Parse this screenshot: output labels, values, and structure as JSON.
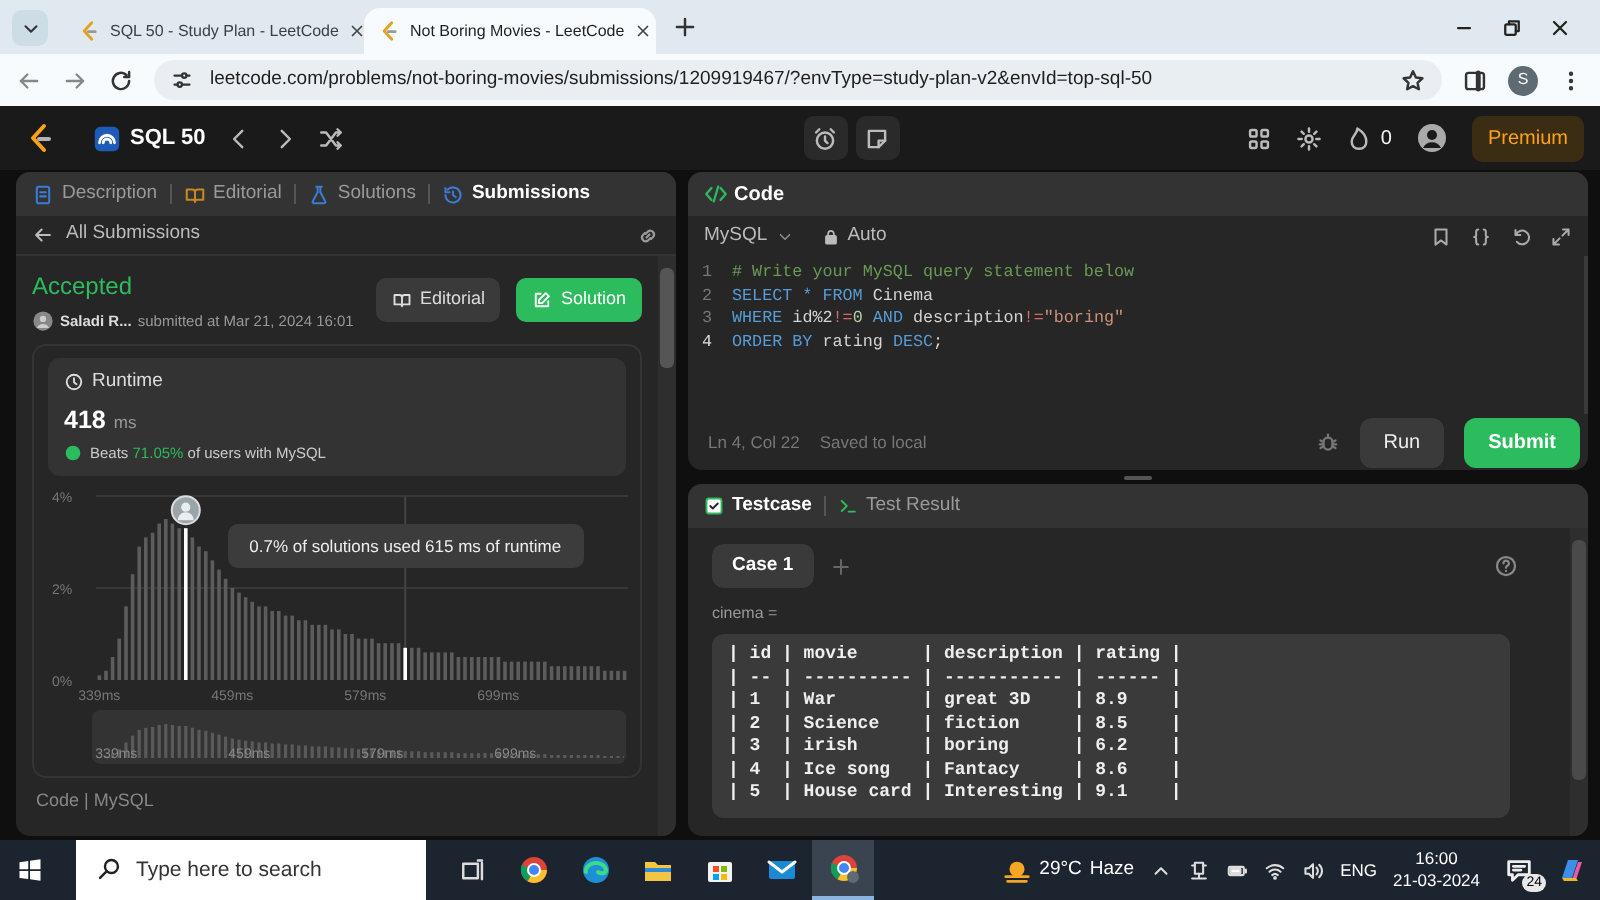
{
  "browser": {
    "tabs": [
      {
        "title": "SQL 50 - Study Plan - LeetCode",
        "selected": false
      },
      {
        "title": "Not Boring Movies - LeetCode",
        "selected": true
      }
    ],
    "url": "leetcode.com/problems/not-boring-movies/submissions/1209919467/?envType=study-plan-v2&envId=top-sql-50",
    "profile_initial": "S"
  },
  "nav": {
    "study_plan": "SQL 50",
    "streak": "0",
    "premium": "Premium"
  },
  "left_panel": {
    "tabs": [
      {
        "label": "Description",
        "selected": false,
        "kind": "description"
      },
      {
        "label": "Editorial",
        "selected": false,
        "kind": "editorial"
      },
      {
        "label": "Solutions",
        "selected": false,
        "kind": "solutions"
      },
      {
        "label": "Submissions",
        "selected": true,
        "kind": "submissions"
      }
    ],
    "back_link": "All Submissions",
    "status": "Accepted",
    "user": "Saladi R...",
    "submitted": "submitted at Mar 21, 2024 16:01",
    "buttons": [
      {
        "label": "Editorial",
        "kind": "secondary"
      },
      {
        "label": "Solution",
        "kind": "primary"
      }
    ],
    "runtime": {
      "title": "Runtime",
      "value": "418",
      "unit": "ms",
      "beats_label": "Beats",
      "beats_pct": "71.05%",
      "beats_rest": "of users with MySQL",
      "chart_data": {
        "type": "bar",
        "xlim": [
          336,
          816
        ],
        "ylim": [
          0,
          4
        ],
        "ref_lines": [
          {
            "axis": "x",
            "value": 615
          }
        ],
        "x": [
          339,
          345,
          351,
          357,
          363,
          369,
          375,
          381,
          387,
          393,
          399,
          405,
          411,
          417,
          423,
          429,
          435,
          441,
          447,
          453,
          459,
          465,
          471,
          477,
          483,
          489,
          495,
          501,
          507,
          513,
          519,
          525,
          531,
          537,
          543,
          549,
          555,
          561,
          567,
          573,
          579,
          585,
          591,
          597,
          603,
          609,
          615,
          621,
          627,
          633,
          639,
          645,
          651,
          657,
          663,
          669,
          675,
          681,
          687,
          693,
          699,
          705,
          711,
          717,
          723,
          729,
          735,
          741,
          747,
          753,
          759,
          765,
          771,
          777,
          783,
          789,
          795,
          801,
          807,
          813
        ],
        "series": [
          {
            "color": "#5c5c5c",
            "values": [
              0.1,
              0.2,
              0.5,
              0.9,
              1.6,
              2.3,
              2.9,
              3.1,
              3.2,
              3.4,
              3.5,
              3.4,
              3.3,
              null,
              3.1,
              2.9,
              2.8,
              2.6,
              2.4,
              2.2,
              2.0,
              1.9,
              1.8,
              1.7,
              1.6,
              1.6,
              1.5,
              1.5,
              1.4,
              1.4,
              1.3,
              1.3,
              1.2,
              1.2,
              1.2,
              1.1,
              1.1,
              1.0,
              1.0,
              0.9,
              0.9,
              0.9,
              0.8,
              0.8,
              0.8,
              0.8,
              null,
              0.7,
              0.7,
              0.6,
              0.6,
              0.6,
              0.6,
              0.6,
              0.5,
              0.5,
              0.5,
              0.5,
              0.5,
              0.5,
              0.5,
              0.4,
              0.4,
              0.4,
              0.4,
              0.4,
              0.4,
              0.4,
              0.3,
              0.3,
              0.3,
              0.3,
              0.3,
              0.3,
              0.3,
              0.3,
              0.2,
              0.2,
              0.2,
              0.2
            ]
          },
          {
            "color": "#ffffff",
            "values": [
              null,
              null,
              null,
              null,
              null,
              null,
              null,
              null,
              null,
              null,
              null,
              null,
              null,
              3.3,
              null,
              null,
              null,
              null,
              null,
              null,
              null,
              null,
              null,
              null,
              null,
              null,
              null,
              null,
              null,
              null,
              null,
              null,
              null,
              null,
              null,
              null,
              null,
              null,
              null,
              null,
              null,
              null,
              null,
              null,
              null,
              null,
              0.7,
              null,
              null,
              null,
              null,
              null,
              null,
              null,
              null,
              null,
              null,
              null,
              null,
              null,
              null,
              null,
              null,
              null,
              null,
              null,
              null,
              null,
              null,
              null,
              null,
              null,
              null,
              null,
              null,
              null,
              null,
              null,
              null,
              null
            ]
          }
        ],
        "xticks": [
          {
            "value": 339,
            "label": "339ms"
          },
          {
            "value": 459,
            "label": "459ms"
          },
          {
            "value": 579,
            "label": "579ms"
          },
          {
            "value": 699,
            "label": "699ms"
          }
        ],
        "yticks": [
          {
            "value": 0,
            "label": "0%"
          },
          {
            "value": 2,
            "label": "2%"
          },
          {
            "value": 4,
            "label": "4%"
          }
        ],
        "annotations": [
          "0.7% of solutions used 615 ms of runtime"
        ]
      },
      "overview_ticks": [
        "339ms",
        "459ms",
        "579ms",
        "699ms"
      ]
    },
    "footer": "Code | MySQL"
  },
  "code_panel": {
    "title": "Code",
    "language": "MySQL",
    "mode": "Auto",
    "lines": [
      {
        "n": "1",
        "current": false,
        "tokens": [
          {
            "kind": "comment",
            "t": "# Write your MySQL query statement below"
          }
        ]
      },
      {
        "n": "2",
        "current": false,
        "tokens": [
          {
            "kind": "kw",
            "t": "SELECT * FROM"
          },
          {
            "kind": "plain",
            "t": " Cinema"
          }
        ]
      },
      {
        "n": "3",
        "current": false,
        "tokens": [
          {
            "kind": "kw",
            "t": "WHERE"
          },
          {
            "kind": "plain",
            "t": " id%2"
          },
          {
            "kind": "op",
            "t": "!="
          },
          {
            "kind": "num",
            "t": "0"
          },
          {
            "kind": "kw",
            "t": " AND"
          },
          {
            "kind": "plain",
            "t": " description"
          },
          {
            "kind": "op",
            "t": "!="
          },
          {
            "kind": "str",
            "t": "\"boring\""
          }
        ]
      },
      {
        "n": "4",
        "current": true,
        "tokens": [
          {
            "kind": "kw",
            "t": "ORDER BY"
          },
          {
            "kind": "plain",
            "t": " rating "
          },
          {
            "kind": "kw",
            "t": "DESC"
          },
          {
            "kind": "plain",
            "t": ";"
          }
        ]
      }
    ],
    "cursor": "Ln 4, Col 22",
    "save_state": "Saved to local",
    "run": "Run",
    "submit": "Submit"
  },
  "test_panel": {
    "tabs": [
      {
        "label": "Testcase",
        "selected": true,
        "kind": "testcase"
      },
      {
        "label": "Test Result",
        "selected": false,
        "kind": "result"
      }
    ],
    "cases": [
      {
        "label": "Case 1",
        "selected": true
      }
    ],
    "param": "cinema =",
    "table_lines": [
      "| id | movie      | description | rating |",
      "| -- | ---------- | ----------- | ------ |",
      "| 1  | War        | great 3D    | 8.9    |",
      "| 2  | Science    | fiction     | 8.5    |",
      "| 3  | irish      | boring      | 6.2    |",
      "| 4  | Ice song   | Fantacy     | 8.6    |",
      "| 5  | House card | Interesting | 9.1    |"
    ]
  },
  "taskbar": {
    "search_placeholder": "Type here to search",
    "apps": [
      {
        "kind": "browser-round",
        "selected": false
      },
      {
        "kind": "browser-wave",
        "selected": false
      },
      {
        "kind": "folder",
        "selected": false
      },
      {
        "kind": "store",
        "selected": false
      },
      {
        "kind": "mail",
        "selected": false
      },
      {
        "kind": "browser-profile",
        "selected": true
      }
    ],
    "weather": {
      "temp": "29°C",
      "desc": "Haze"
    },
    "language": "ENG",
    "time": "16:00",
    "date": "21-03-2024",
    "notifications": "24"
  }
}
